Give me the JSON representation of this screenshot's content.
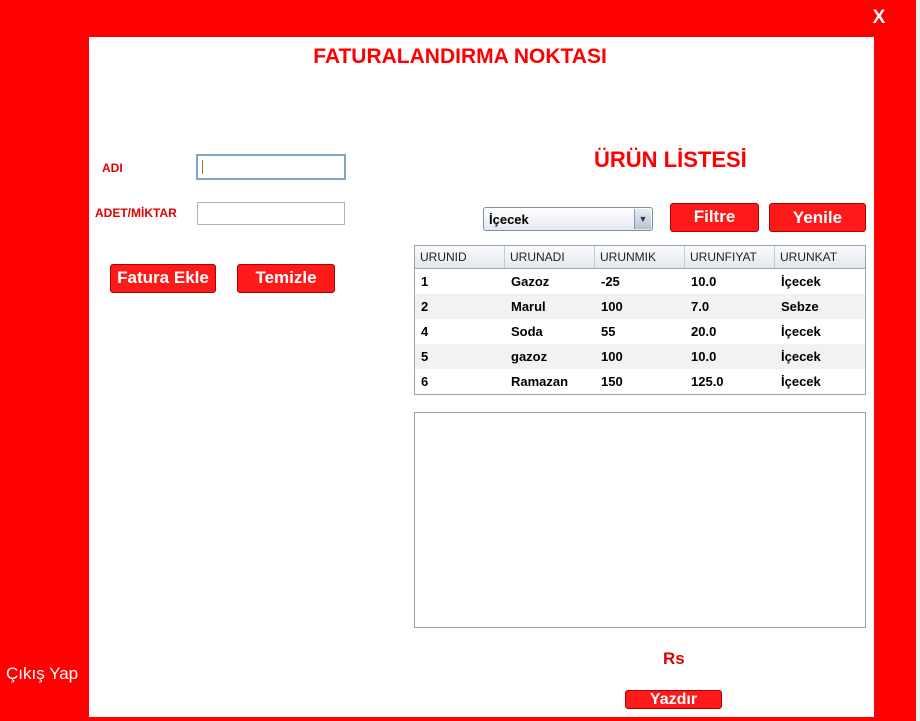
{
  "window": {
    "close_label": "X"
  },
  "title": "FATURALANDIRMA NOKTASI",
  "form": {
    "name_label": "ADI",
    "name_value": "",
    "quantity_label": "ADET/MİKTAR",
    "quantity_value": "",
    "add_invoice_button": "Fatura Ekle",
    "clear_button": "Temizle"
  },
  "product_list": {
    "title": "ÜRÜN LİSTESİ",
    "category_select": "İçecek",
    "filter_button": "Filtre",
    "refresh_button": "Yenile",
    "columns": [
      "URUNID",
      "URUNADI",
      "URUNMIK",
      "URUNFIYAT",
      "URUNKAT"
    ],
    "rows": [
      [
        "1",
        "Gazoz",
        "-25",
        "10.0",
        "İçecek"
      ],
      [
        "2",
        "Marul",
        "100",
        "7.0",
        "Sebze"
      ],
      [
        "4",
        "Soda",
        "55",
        "20.0",
        "İçecek"
      ],
      [
        "5",
        "gazoz",
        "100",
        "10.0",
        "İçecek"
      ],
      [
        "6",
        "Ramazan",
        "150",
        "125.0",
        "İçecek"
      ]
    ]
  },
  "invoice_text": "",
  "total_label": "Rs",
  "print_button": "Yazdır",
  "logout_label": "Çıkış Yap"
}
